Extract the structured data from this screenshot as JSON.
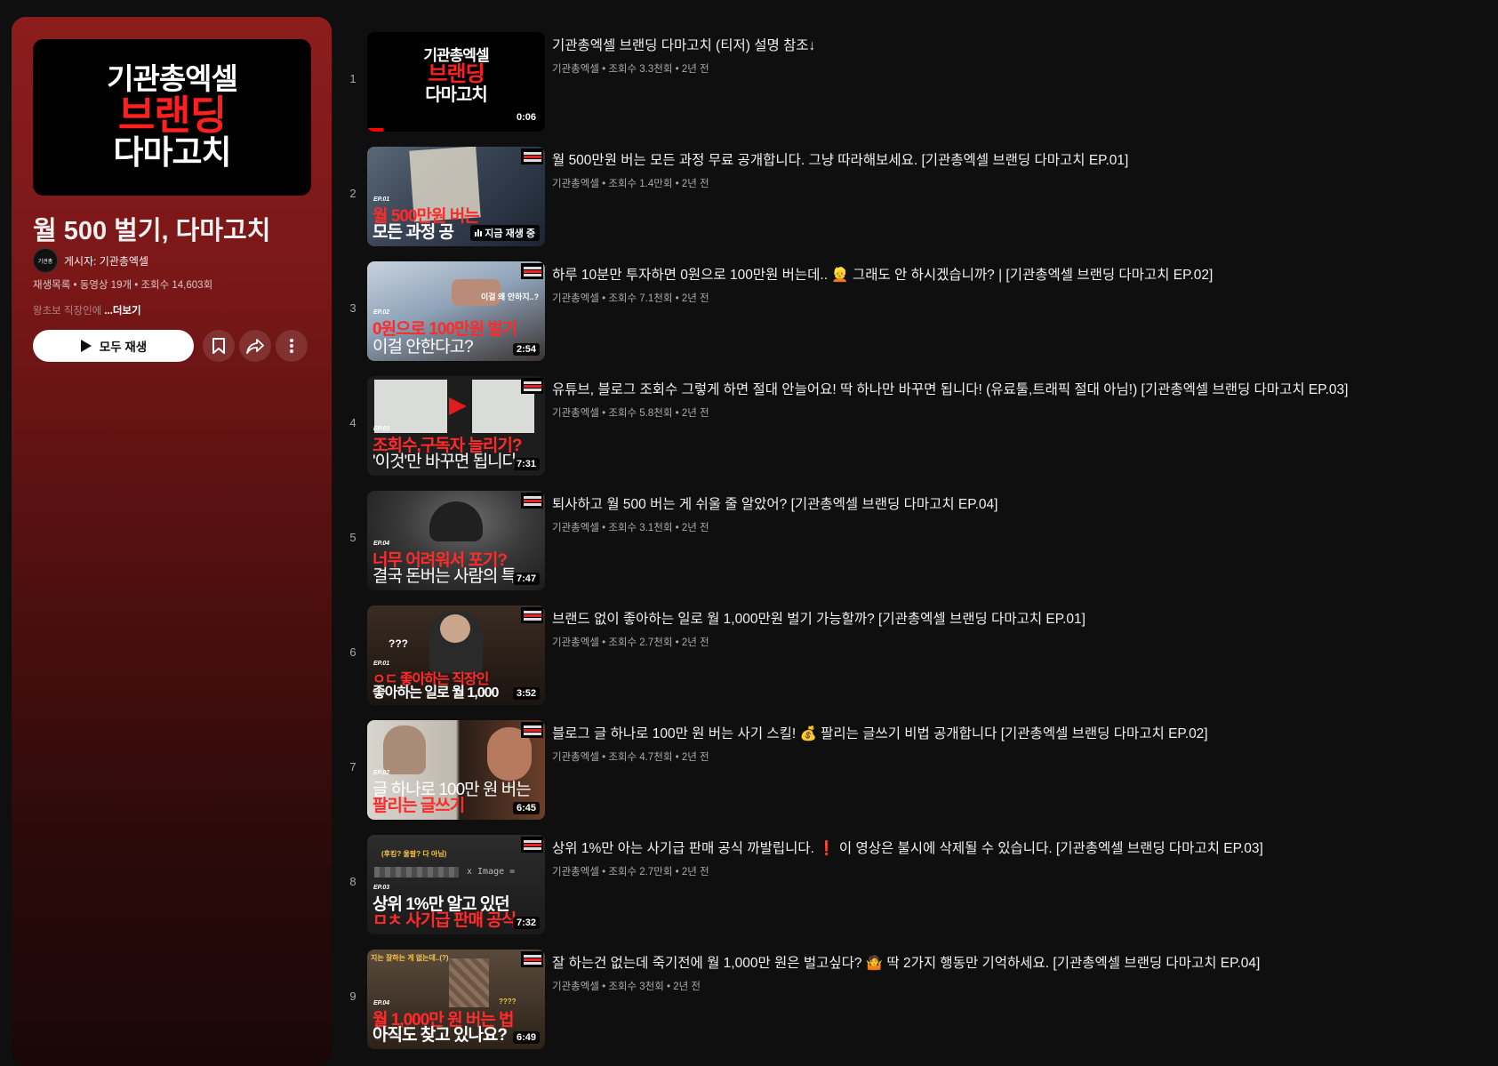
{
  "playlist": {
    "thumb_lines": [
      "기관총엑셀",
      "브랜딩",
      "다마고치"
    ],
    "title": "월 500 벌기, 다마고치",
    "avatar_text": "기관총",
    "owner_label": "게시자: 기관총엑셀",
    "meta": "재생목록 • 동영상 19개 • 조회수 14,603회",
    "desc": "왕초보 직장인에",
    "more": "...더보기",
    "play_all": "모두 재생"
  },
  "videos": [
    {
      "index": "1",
      "title": "기관총엑셀 브랜딩 다마고치 (티저) 설명 참조↓",
      "meta": "기관총엑셀 • 조회수 3.3천회 • 2년 전",
      "duration": "0:06",
      "progress": 0.09,
      "thumb": {
        "ep": "",
        "l1": "",
        "l2": ""
      }
    },
    {
      "index": "2",
      "title": "월 500만원 버는 모든 과정 무료 공개합니다. 그냥 따라해보세요. [기관총엑셀 브랜딩 다마고치 EP.01]",
      "meta": "기관총엑셀 • 조회수 1.4만회 • 2년 전",
      "duration": "",
      "now_playing": "지금 재생 중",
      "thumb": {
        "ep": "EP.01",
        "l1": "월 500만원 버는",
        "l2": "모든 과정 공"
      }
    },
    {
      "index": "3",
      "title": "하루 10분만 투자하면 0원으로 100만원 버는데.. 👱 그래도 안 하시겠습니까? | [기관총엑셀 브랜딩 다마고치 EP.02]",
      "meta": "기관총엑셀 • 조회수 7.1천회 • 2년 전",
      "duration": "2:54",
      "thumb": {
        "ep": "EP.02",
        "l1": "0원으로 100만원 벌기",
        "l2": "이걸 안한다고?",
        "note": "이걸 왜 안하지..?"
      }
    },
    {
      "index": "4",
      "title": "유튜브, 블로그 조회수 그렇게 하면 절대 안늘어요! 딱 하나만 바꾸면 됩니다! (유료툴,트래픽 절대 아님!) [기관총엑셀 브랜딩 다마고치 EP.03]",
      "meta": "기관총엑셀 • 조회수 5.8천회 • 2년 전",
      "duration": "7:31",
      "thumb": {
        "ep": "EP.03",
        "l1": "조회수,구독자 늘리기?",
        "l2": "'이것'만 바꾸면 됩니다"
      }
    },
    {
      "index": "5",
      "title": "퇴사하고 월 500 버는 게 쉬울 줄 알았어? [기관총엑셀 브랜딩 다마고치 EP.04]",
      "meta": "기관총엑셀 • 조회수 3.1천회 • 2년 전",
      "duration": "7:47",
      "thumb": {
        "ep": "EP.04",
        "l1": "너무 어려워서 포기?",
        "l2": "결국 돈버는 사람의 특"
      }
    },
    {
      "index": "6",
      "title": "브랜드 없이 좋아하는 일로 월 1,000만원 벌기 가능할까? [기관총엑셀 브랜딩 다마고치 EP.01]",
      "meta": "기관총엑셀 • 조회수 2.7천회 • 2년 전",
      "duration": "3:52",
      "thumb": {
        "ep": "EP.01",
        "l1": "ㅇㄷ 좋아하는 직장인",
        "l2": "좋아하는 일로 월 1,000",
        "note": "???"
      }
    },
    {
      "index": "7",
      "title": "블로그 글 하나로 100만 원 버는 사기 스킬! 💰 팔리는 글쓰기 비법 공개합니다 [기관총엑셀 브랜딩 다마고치 EP.02]",
      "meta": "기관총엑셀 • 조회수 4.7천회 • 2년 전",
      "duration": "6:45",
      "thumb": {
        "ep": "EP.02",
        "l1": "글 하나로 100만 원 버는",
        "l2": "팔리는 글쓰기"
      }
    },
    {
      "index": "8",
      "title": "상위 1%만 아는 사기급 판매 공식 까발립니다. ❗ 이 영상은 불시에 삭제될 수 있습니다. [기관총엑셀 브랜딩 다마고치 EP.03]",
      "meta": "기관총엑셀 • 조회수 2.7만회 • 2년 전",
      "duration": "7:32",
      "thumb": {
        "ep": "EP.03",
        "l1": "상위 1%만 알고 있던",
        "l2": "ㅁㅊ 사기급 판매 공식",
        "note": "(후킹? 울팔? 다 아님)",
        "note2": "x Image ="
      }
    },
    {
      "index": "9",
      "title": "잘 하는건 없는데 죽기전에 월 1,000만 원은 벌고싶다? 🤷 딱 2가지 행동만 기억하세요. [기관총엑셀 브랜딩 다마고치 EP.04]",
      "meta": "기관총엑셀 • 조회수 3천회 • 2년 전",
      "duration": "6:49",
      "thumb": {
        "ep": "EP.04",
        "l1": "월 1,000만 원 버는 법",
        "l2": "아직도 찾고 있나요?",
        "note": "지는 잘하는 게 없는데..(?)",
        "note2": "????"
      }
    }
  ]
}
